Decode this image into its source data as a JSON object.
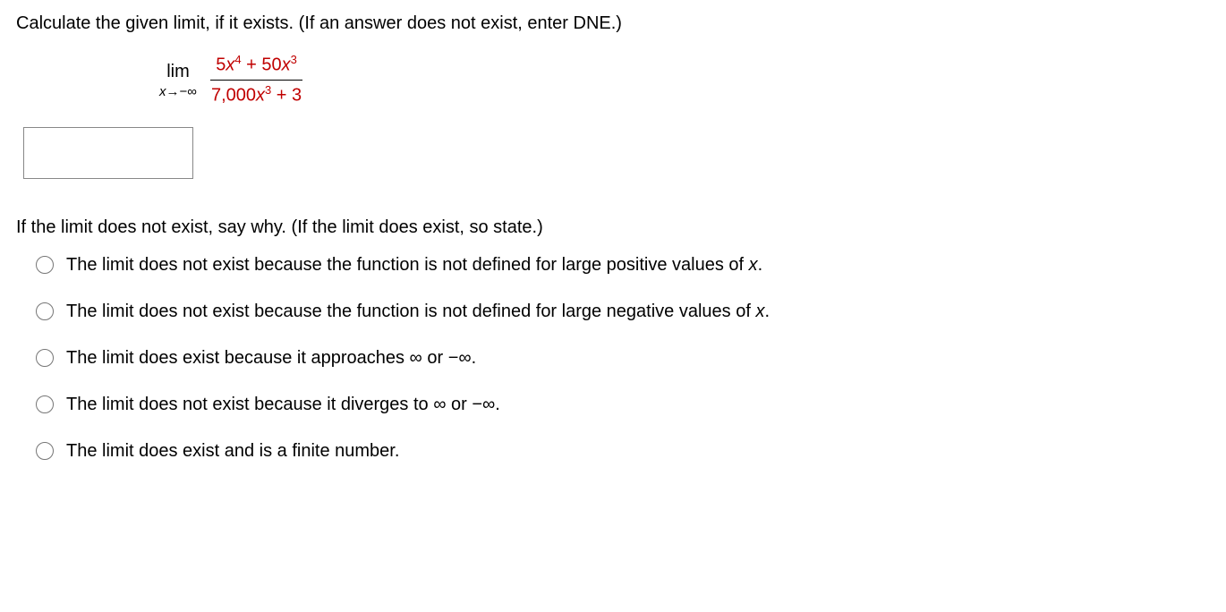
{
  "question": {
    "prompt": "Calculate the given limit, if it exists. (If an answer does not exist, enter DNE.)",
    "lim_label": "lim",
    "lim_approach_var": "x",
    "lim_approach_arrow": "→",
    "lim_approach_target": "−∞",
    "numerator_coef1": "5",
    "numerator_exp1": "4",
    "numerator_plus": " + ",
    "numerator_coef2": "50",
    "numerator_exp2": "3",
    "denominator_coef1": "7,000",
    "denominator_exp1": "3",
    "denominator_plus": " + ",
    "denominator_const": "3",
    "answer_value": ""
  },
  "sub_question": "If the limit does not exist, say why. (If the limit does exist, so state.)",
  "options": [
    {
      "label": "The limit does not exist because the function is not defined for large positive values of x."
    },
    {
      "label": "The limit does not exist because the function is not defined for large negative values of x."
    },
    {
      "label": "The limit does exist because it approaches ∞ or −∞."
    },
    {
      "label": "The limit does not exist because it diverges to ∞ or −∞."
    },
    {
      "label": "The limit does exist and is a finite number."
    }
  ]
}
